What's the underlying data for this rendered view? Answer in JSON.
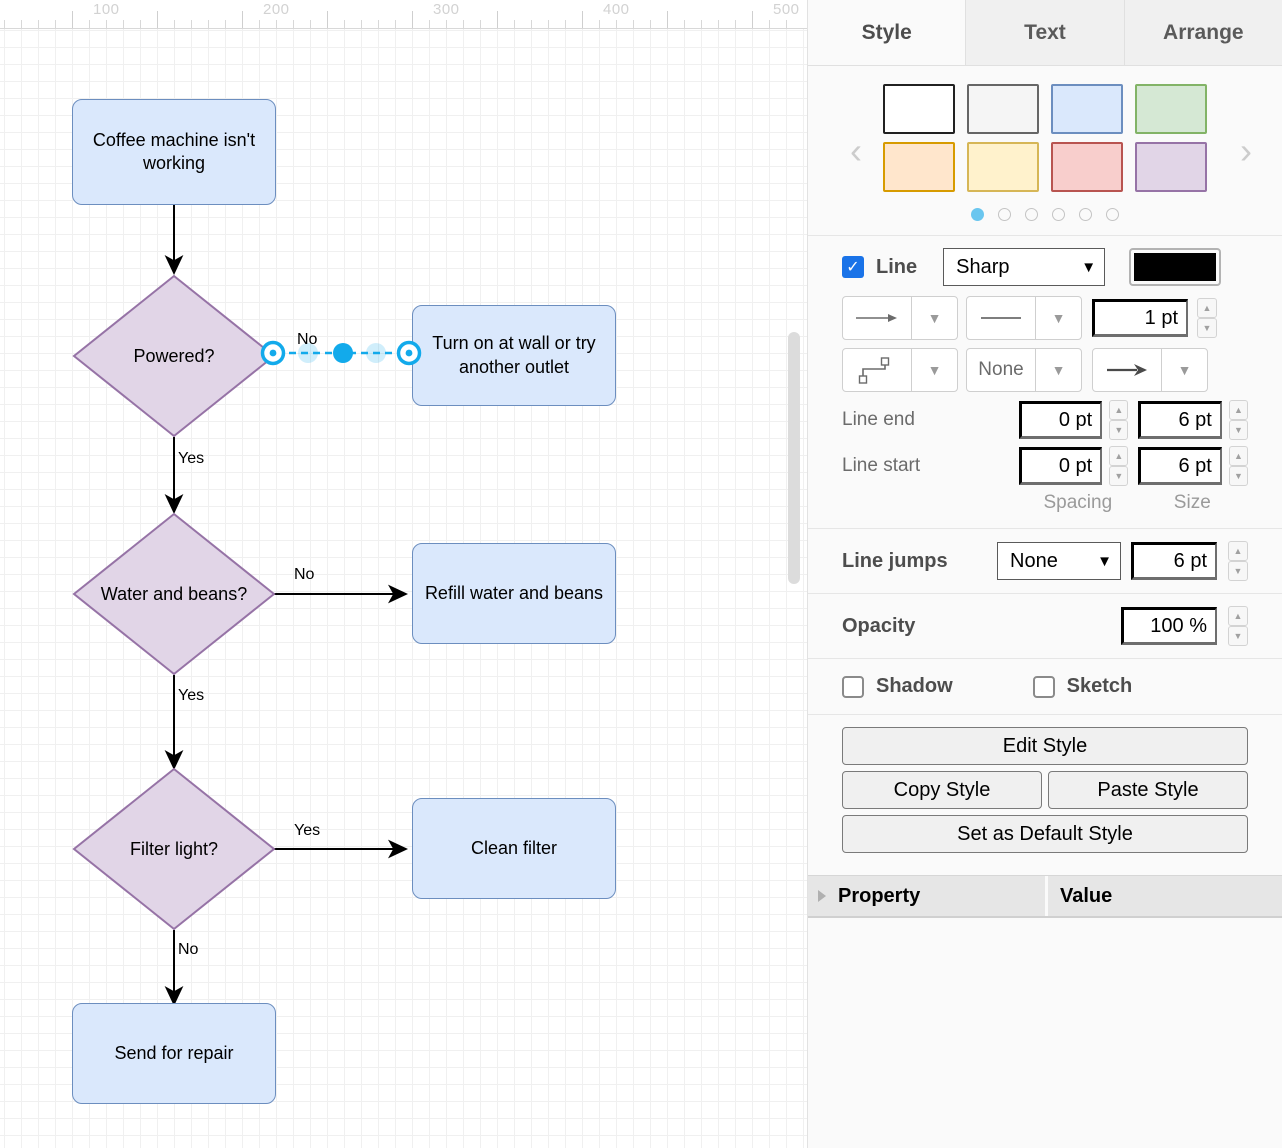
{
  "canvas": {
    "ruler": {
      "labels": [
        "100",
        "200",
        "300",
        "400",
        "500"
      ]
    },
    "nodes": [
      {
        "id": "n1",
        "text": "Coffee machine isn't working",
        "shape": "rounded-rect",
        "fill": "#dae8fc",
        "stroke": "#6c8ebf"
      },
      {
        "id": "n2",
        "text": "Powered?",
        "shape": "diamond",
        "fill": "#e1d5e7",
        "stroke": "#9673a6"
      },
      {
        "id": "n3",
        "text": "Turn on at wall or try another outlet",
        "shape": "rounded-rect",
        "fill": "#dae8fc",
        "stroke": "#6c8ebf"
      },
      {
        "id": "n4",
        "text": "Water and beans?",
        "shape": "diamond",
        "fill": "#e1d5e7",
        "stroke": "#9673a6"
      },
      {
        "id": "n5",
        "text": "Refill water and beans",
        "shape": "rounded-rect",
        "fill": "#dae8fc",
        "stroke": "#6c8ebf"
      },
      {
        "id": "n6",
        "text": "Filter light?",
        "shape": "diamond",
        "fill": "#e1d5e7",
        "stroke": "#9673a6"
      },
      {
        "id": "n7",
        "text": "Clean filter",
        "shape": "rounded-rect",
        "fill": "#dae8fc",
        "stroke": "#6c8ebf"
      },
      {
        "id": "n8",
        "text": "Send for repair",
        "shape": "rounded-rect",
        "fill": "#dae8fc",
        "stroke": "#6c8ebf"
      }
    ],
    "edge_labels": {
      "powered_no": "No",
      "powered_yes": "Yes",
      "water_no": "No",
      "water_yes": "Yes",
      "filter_yes": "Yes",
      "filter_no": "No"
    },
    "selection": {
      "selected_edge": "powered_no",
      "handle_color": "#12aaeb"
    }
  },
  "panel": {
    "tabs": [
      {
        "label": "Style",
        "active": true
      },
      {
        "label": "Text",
        "active": false
      },
      {
        "label": "Arrange",
        "active": false
      }
    ],
    "style_picker": {
      "prev_label": "‹",
      "next_label": "›",
      "swatches_row1": [
        {
          "fill": "#ffffff",
          "stroke": "#212121"
        },
        {
          "fill": "#f5f5f5",
          "stroke": "#666666"
        },
        {
          "fill": "#dae8fc",
          "stroke": "#6c8ebf"
        },
        {
          "fill": "#d5e8d4",
          "stroke": "#82b366"
        }
      ],
      "swatches_row2": [
        {
          "fill": "#ffe6cc",
          "stroke": "#d79b00"
        },
        {
          "fill": "#fff2cc",
          "stroke": "#d6b656"
        },
        {
          "fill": "#f8cecc",
          "stroke": "#b85450"
        },
        {
          "fill": "#e1d5e7",
          "stroke": "#9673a6"
        }
      ],
      "page_count": 6,
      "active_page": 1,
      "active_dot_color": "#6ac6ef"
    },
    "line": {
      "enabled": true,
      "label": "Line",
      "style_select": "Sharp",
      "color": "#000000",
      "arrow_button_icon": "line-start-arrow-icon",
      "dash_button_icon": "solid-line-icon",
      "width_value": "1 pt",
      "waypoint_button_icon": "orthogonal-waypoint-icon",
      "perimeter_select": "None",
      "arrow_end_icon": "arrow-end-icon",
      "line_end_label": "Line end",
      "line_start_label": "Line start",
      "line_end_spacing": "0 pt",
      "line_end_size": "6 pt",
      "line_start_spacing": "0 pt",
      "line_start_size": "6 pt",
      "spacing_caption": "Spacing",
      "size_caption": "Size"
    },
    "line_jumps": {
      "label": "Line jumps",
      "select": "None",
      "size": "6 pt"
    },
    "opacity": {
      "label": "Opacity",
      "value": "100 %"
    },
    "effects": {
      "shadow": {
        "label": "Shadow",
        "checked": false
      },
      "sketch": {
        "label": "Sketch",
        "checked": false
      }
    },
    "buttons": {
      "edit_style": "Edit Style",
      "copy_style": "Copy Style",
      "paste_style": "Paste Style",
      "set_default": "Set as Default Style"
    },
    "property_table": {
      "property_header": "Property",
      "value_header": "Value"
    }
  }
}
